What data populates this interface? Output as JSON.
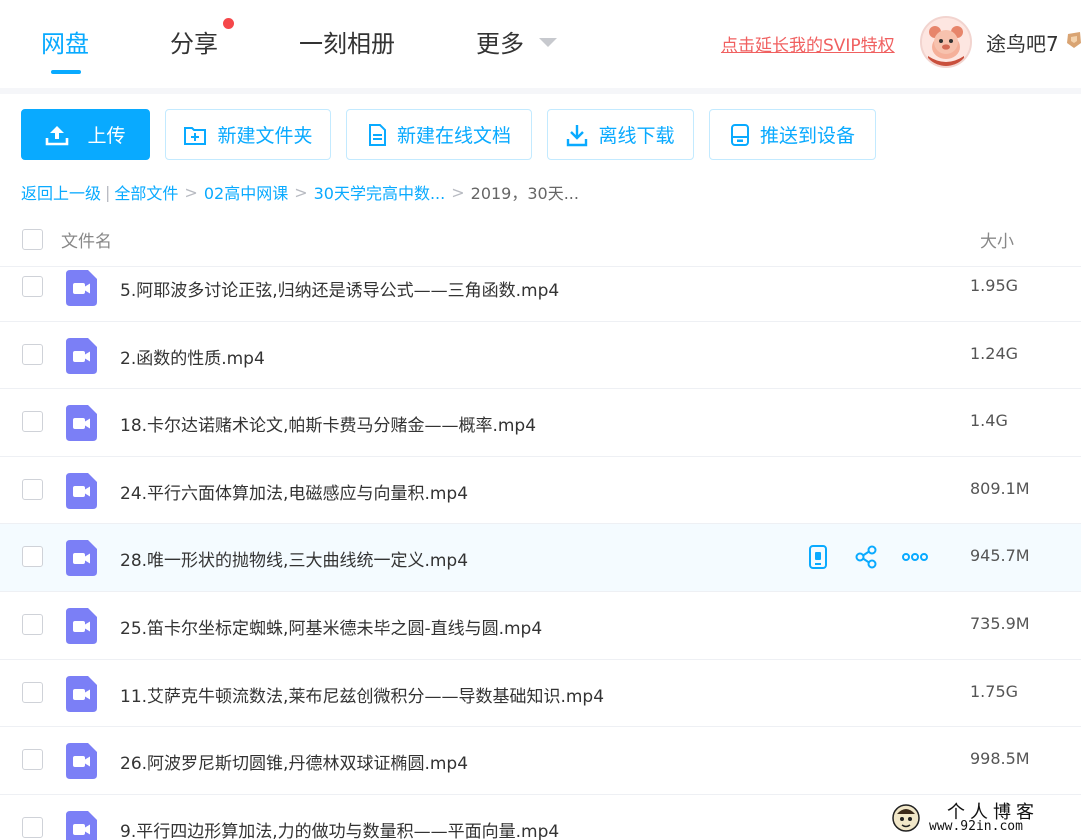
{
  "nav": {
    "tabs": [
      {
        "label": "网盘",
        "active": true
      },
      {
        "label": "分享",
        "has_badge": true
      },
      {
        "label": "一刻相册"
      },
      {
        "label": "更多"
      }
    ],
    "svip_link": "点击延长我的SVIP特权",
    "username": "途鸟吧7"
  },
  "toolbar": {
    "upload": "上传",
    "new_folder": "新建文件夹",
    "new_doc": "新建在线文档",
    "offline_download": "离线下载",
    "push_device": "推送到设备"
  },
  "breadcrumb": {
    "back": "返回上一级",
    "separator": "|",
    "items": [
      "全部文件",
      "02高中网课",
      "30天学完高中数..."
    ],
    "arrow": ">",
    "current": "2019，30天..."
  },
  "table": {
    "col_name": "文件名",
    "col_size": "大小",
    "rows": [
      {
        "name": "5.阿耶波多讨论正弦,归纳还是诱导公式——三角函数.mp4",
        "size": "1.95G"
      },
      {
        "name": "2.函数的性质.mp4",
        "size": "1.24G"
      },
      {
        "name": "18.卡尔达诺赌术论文,帕斯卡费马分赌金——概率.mp4",
        "size": "1.4G"
      },
      {
        "name": "24.平行六面体算加法,电磁感应与向量积.mp4",
        "size": "809.1M"
      },
      {
        "name": "28.唯一形状的抛物线,三大曲线统一定义.mp4",
        "size": "945.7M",
        "hovered": true
      },
      {
        "name": "25.笛卡尔坐标定蜘蛛,阿基米德未毕之圆-直线与圆.mp4",
        "size": "735.9M"
      },
      {
        "name": "11.艾萨克牛顿流数法,莱布尼兹创微积分——导数基础知识.mp4",
        "size": "1.75G"
      },
      {
        "name": "26.阿波罗尼斯切圆锥,丹德林双球证椭圆.mp4",
        "size": "998.5M"
      },
      {
        "name": "9.平行四边形算加法,力的做功与数量积——平面向量.mp4",
        "size": ""
      }
    ]
  },
  "watermark": {
    "title": "个人博客",
    "url": "www.92in.com"
  },
  "colors": {
    "brand": "#09AAFF",
    "svip": "#F06060",
    "badge": "#F5474A",
    "video_icon": "#7B7FF6"
  }
}
